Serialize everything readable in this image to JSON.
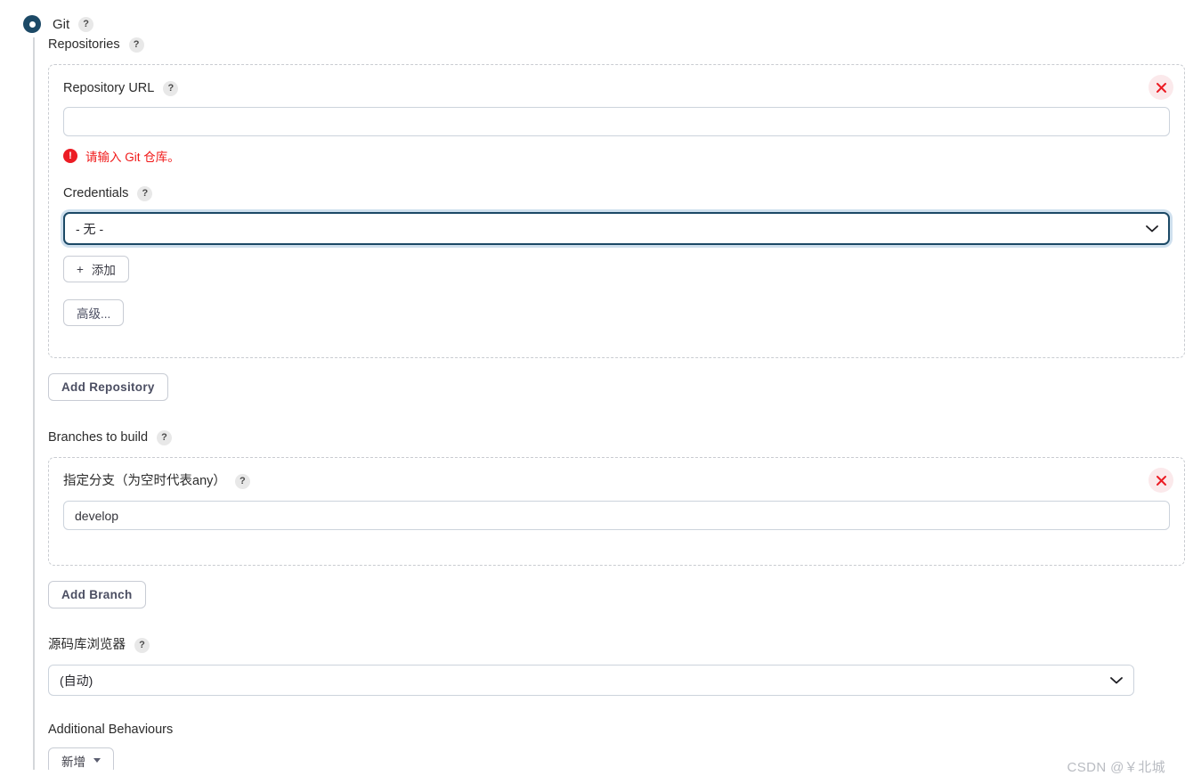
{
  "scm": {
    "label": "Git",
    "help": "?"
  },
  "repositories": {
    "label": "Repositories",
    "help": "?",
    "repo_url": {
      "label": "Repository URL",
      "help": "?",
      "value": "",
      "error_text": "请输入 Git 仓库。",
      "error_icon": "!"
    },
    "credentials": {
      "label": "Credentials",
      "help": "?",
      "selected": "- 无 -",
      "options": [
        "- 无 -"
      ],
      "add_label": "添加",
      "add_icon": "+",
      "advanced_label": "高级..."
    },
    "delete_icon": "close-x",
    "add_repository_label": "Add Repository"
  },
  "branches": {
    "label": "Branches to build",
    "help": "?",
    "branch_spec": {
      "label": "指定分支（为空时代表any）",
      "help": "?",
      "value": "develop"
    },
    "delete_icon": "close-x",
    "add_branch_label": "Add Branch"
  },
  "repository_browser": {
    "label": "源码库浏览器",
    "help": "?",
    "selected": "(自动)",
    "options": [
      "(自动)"
    ]
  },
  "additional_behaviours": {
    "label": "Additional Behaviours",
    "add_label": "新增",
    "caret_icon": "caret-down"
  },
  "watermark": "CSDN @￥北城",
  "colors": {
    "radio_fill": "#1c4966",
    "error": "#ec1c24",
    "border": "#ccd3dc",
    "dashed_border": "#c9ccd1",
    "button_text": "#4b4e62"
  }
}
